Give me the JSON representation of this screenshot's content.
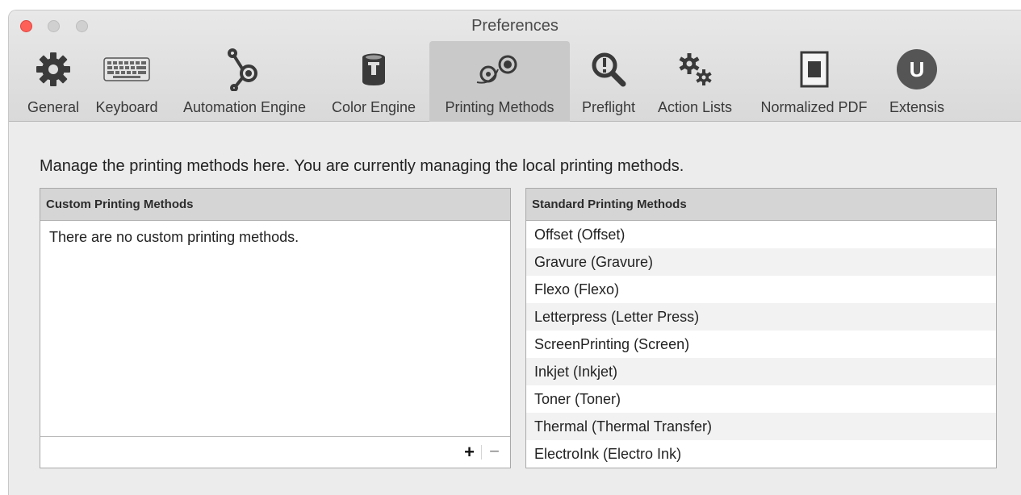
{
  "window": {
    "title": "Preferences"
  },
  "toolbar": {
    "items": [
      {
        "label": "General",
        "icon": "gear-icon"
      },
      {
        "label": "Keyboard",
        "icon": "keyboard-icon"
      },
      {
        "label": "Automation Engine",
        "icon": "automation-engine-icon"
      },
      {
        "label": "Color Engine",
        "icon": "paint-can-icon"
      },
      {
        "label": "Printing Methods",
        "icon": "printing-rollers-icon",
        "selected": true
      },
      {
        "label": "Preflight",
        "icon": "magnifier-icon"
      },
      {
        "label": "Action Lists",
        "icon": "gears-icon"
      },
      {
        "label": "Normalized PDF",
        "icon": "document-icon"
      },
      {
        "label": "Extensis",
        "icon": "extensis-logo-icon",
        "logo_text": "U"
      }
    ]
  },
  "description": "Manage the printing methods here. You are currently managing the local printing methods.",
  "custom_panel": {
    "header": "Custom Printing Methods",
    "empty_text": "There are no custom printing methods.",
    "add_label": "+",
    "remove_label": "−"
  },
  "standard_panel": {
    "header": "Standard Printing Methods",
    "rows": [
      "Offset (Offset)",
      "Gravure (Gravure)",
      "Flexo (Flexo)",
      "Letterpress (Letter Press)",
      "ScreenPrinting (Screen)",
      "Inkjet (Inkjet)",
      "Toner (Toner)",
      "Thermal (Thermal Transfer)",
      "ElectroInk (Electro Ink)"
    ]
  },
  "colors": {
    "close": "#fe5f57",
    "selected_tab": "#c9c9c9",
    "icon": "#3a3a3a"
  }
}
